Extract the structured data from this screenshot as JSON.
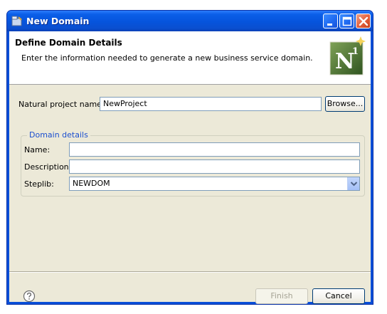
{
  "window": {
    "title": "New Domain"
  },
  "banner": {
    "title": "Define Domain Details",
    "description": "Enter the information needed to generate a new business service domain.",
    "logo_text": "N",
    "logo_superscript": "1"
  },
  "project": {
    "label": "Natural project name:",
    "value": "NewProject",
    "browse_label": "Browse..."
  },
  "domain_details": {
    "group_title": "Domain details",
    "name_label": "Name:",
    "name_value": "",
    "description_label": "Description:",
    "description_value": "",
    "steplib_label": "Steplib:",
    "steplib_value": "NEWDOM"
  },
  "footer": {
    "finish_label": "Finish",
    "cancel_label": "Cancel"
  },
  "colors": {
    "titlebar": "#0a5ee8",
    "dialog_bg": "#ece9d8",
    "group_title": "#1c4fcf",
    "logo_green": "#3f6b2a"
  }
}
